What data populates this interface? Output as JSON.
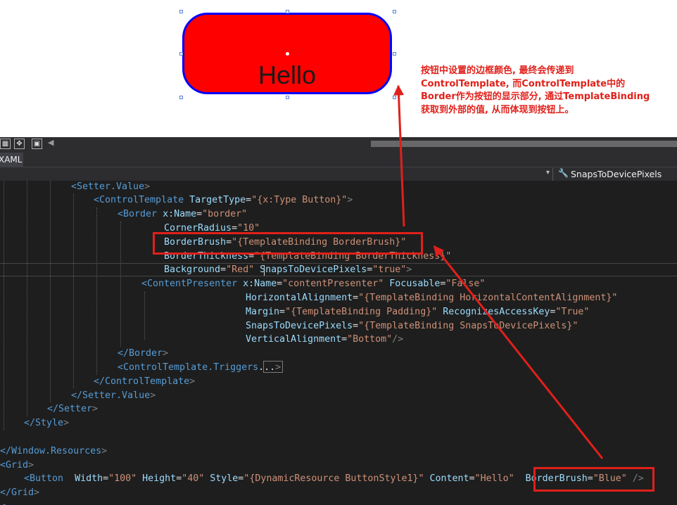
{
  "designer": {
    "button_label": "Hello",
    "annotation_lines": [
      "按钮中设置的边框颜色, 最终会传递到",
      "ControlTemplate, 而ControlTemplate中的",
      "Border作为按钮的显示部分, 通过TemplateBinding",
      "获取到外部的值, 从而体现到按钮上。"
    ]
  },
  "toolbar": {
    "icons": [
      "grid-icon",
      "snap-icon",
      "artboard-icon"
    ],
    "scroll_left_glyph": "◀"
  },
  "tab": {
    "label": "XAML"
  },
  "nav": {
    "member": "SnapsToDevicePixels",
    "dropdown_glyph": "▾",
    "wrench_glyph": "🔧"
  },
  "colors": {
    "highlight": "#e0201a",
    "button_fill": "#ff0000",
    "button_border": "#0000ff"
  },
  "code": {
    "lines": [
      [
        [
          "t",
          "<Setter.Value"
        ],
        [
          "p",
          ">"
        ]
      ],
      [
        [
          "t",
          "<ControlTemplate"
        ],
        [
          "x",
          " "
        ],
        [
          "a",
          "TargetType"
        ],
        [
          "x",
          "="
        ],
        [
          "v",
          "\"{x:Type Button}\""
        ],
        [
          "p",
          ">"
        ]
      ],
      [
        [
          "t",
          "<Border"
        ],
        [
          "x",
          " "
        ],
        [
          "a",
          "x:Name"
        ],
        [
          "x",
          "="
        ],
        [
          "v",
          "\"border\""
        ]
      ],
      [
        [
          "a",
          "CornerRadius"
        ],
        [
          "x",
          "="
        ],
        [
          "v",
          "\"10\""
        ]
      ],
      [
        [
          "a",
          "BorderBrush"
        ],
        [
          "x",
          "="
        ],
        [
          "v",
          "\"{TemplateBinding BorderBrush}\""
        ]
      ],
      [
        [
          "a",
          "BorderThickness"
        ],
        [
          "x",
          "="
        ],
        [
          "v",
          "\"{TemplateBinding BorderThickness}\""
        ]
      ],
      [
        [
          "a",
          "Background"
        ],
        [
          "x",
          "="
        ],
        [
          "v",
          "\"Red\""
        ],
        [
          "x",
          " "
        ],
        [
          "a",
          "SnapsToDevicePixels"
        ],
        [
          "x",
          "="
        ],
        [
          "v",
          "\"true\""
        ],
        [
          "p",
          ">"
        ]
      ],
      [
        [
          "t",
          "<ContentPresenter"
        ],
        [
          "x",
          " "
        ],
        [
          "a",
          "x:Name"
        ],
        [
          "x",
          "="
        ],
        [
          "v",
          "\"contentPresenter\""
        ],
        [
          "x",
          " "
        ],
        [
          "a",
          "Focusable"
        ],
        [
          "x",
          "="
        ],
        [
          "v",
          "\"False\""
        ]
      ],
      [
        [
          "a",
          "HorizontalAlignment"
        ],
        [
          "x",
          "="
        ],
        [
          "v",
          "\"{TemplateBinding HorizontalContentAlignment}\""
        ]
      ],
      [
        [
          "a",
          "Margin"
        ],
        [
          "x",
          "="
        ],
        [
          "v",
          "\"{TemplateBinding Padding}\""
        ],
        [
          "x",
          " "
        ],
        [
          "a",
          "RecognizesAccessKey"
        ],
        [
          "x",
          "="
        ],
        [
          "v",
          "\"True\""
        ]
      ],
      [
        [
          "a",
          "SnapsToDevicePixels"
        ],
        [
          "x",
          "="
        ],
        [
          "v",
          "\"{TemplateBinding SnapsToDevicePixels}\""
        ]
      ],
      [
        [
          "a",
          "VerticalAlignment"
        ],
        [
          "x",
          "="
        ],
        [
          "v",
          "\"Bottom\""
        ],
        [
          "p",
          "/>"
        ]
      ],
      [
        [
          "t",
          "</Border"
        ],
        [
          "p",
          ">"
        ]
      ],
      [
        [
          "t",
          "<ControlTemplate.Triggers"
        ],
        [
          "x",
          "..."
        ],
        [
          "p",
          ">"
        ]
      ],
      [
        [
          "t",
          "</ControlTemplate"
        ],
        [
          "p",
          ">"
        ]
      ],
      [
        [
          "t",
          "</Setter.Value"
        ],
        [
          "p",
          ">"
        ]
      ],
      [
        [
          "t",
          "</Setter"
        ],
        [
          "p",
          ">"
        ]
      ],
      [
        [
          "t",
          "</Style"
        ],
        [
          "p",
          ">"
        ]
      ],
      [],
      [
        [
          "t",
          "</Window.Resources"
        ],
        [
          "p",
          ">"
        ]
      ],
      [
        [
          "t",
          "<Grid"
        ],
        [
          "p",
          ">"
        ]
      ],
      [
        [
          "t",
          "<Button"
        ],
        [
          "x",
          "  "
        ],
        [
          "a",
          "Width"
        ],
        [
          "x",
          "="
        ],
        [
          "v",
          "\"100\""
        ],
        [
          "x",
          " "
        ],
        [
          "a",
          "Height"
        ],
        [
          "x",
          "="
        ],
        [
          "v",
          "\"40\""
        ],
        [
          "x",
          " "
        ],
        [
          "a",
          "Style"
        ],
        [
          "x",
          "="
        ],
        [
          "v",
          "\"{DynamicResource ButtonStyle1}\""
        ],
        [
          "x",
          " "
        ],
        [
          "a",
          "Content"
        ],
        [
          "x",
          "="
        ],
        [
          "v",
          "\"Hello\""
        ],
        [
          "x",
          "  "
        ],
        [
          "a",
          "BorderBrush"
        ],
        [
          "x",
          "="
        ],
        [
          "v",
          "\"Blue\""
        ],
        [
          "x",
          " "
        ],
        [
          "p",
          "/>"
        ]
      ],
      [
        [
          "t",
          "</Grid"
        ],
        [
          "p",
          ">"
        ]
      ],
      [
        [
          "t",
          "<"
        ]
      ]
    ]
  }
}
